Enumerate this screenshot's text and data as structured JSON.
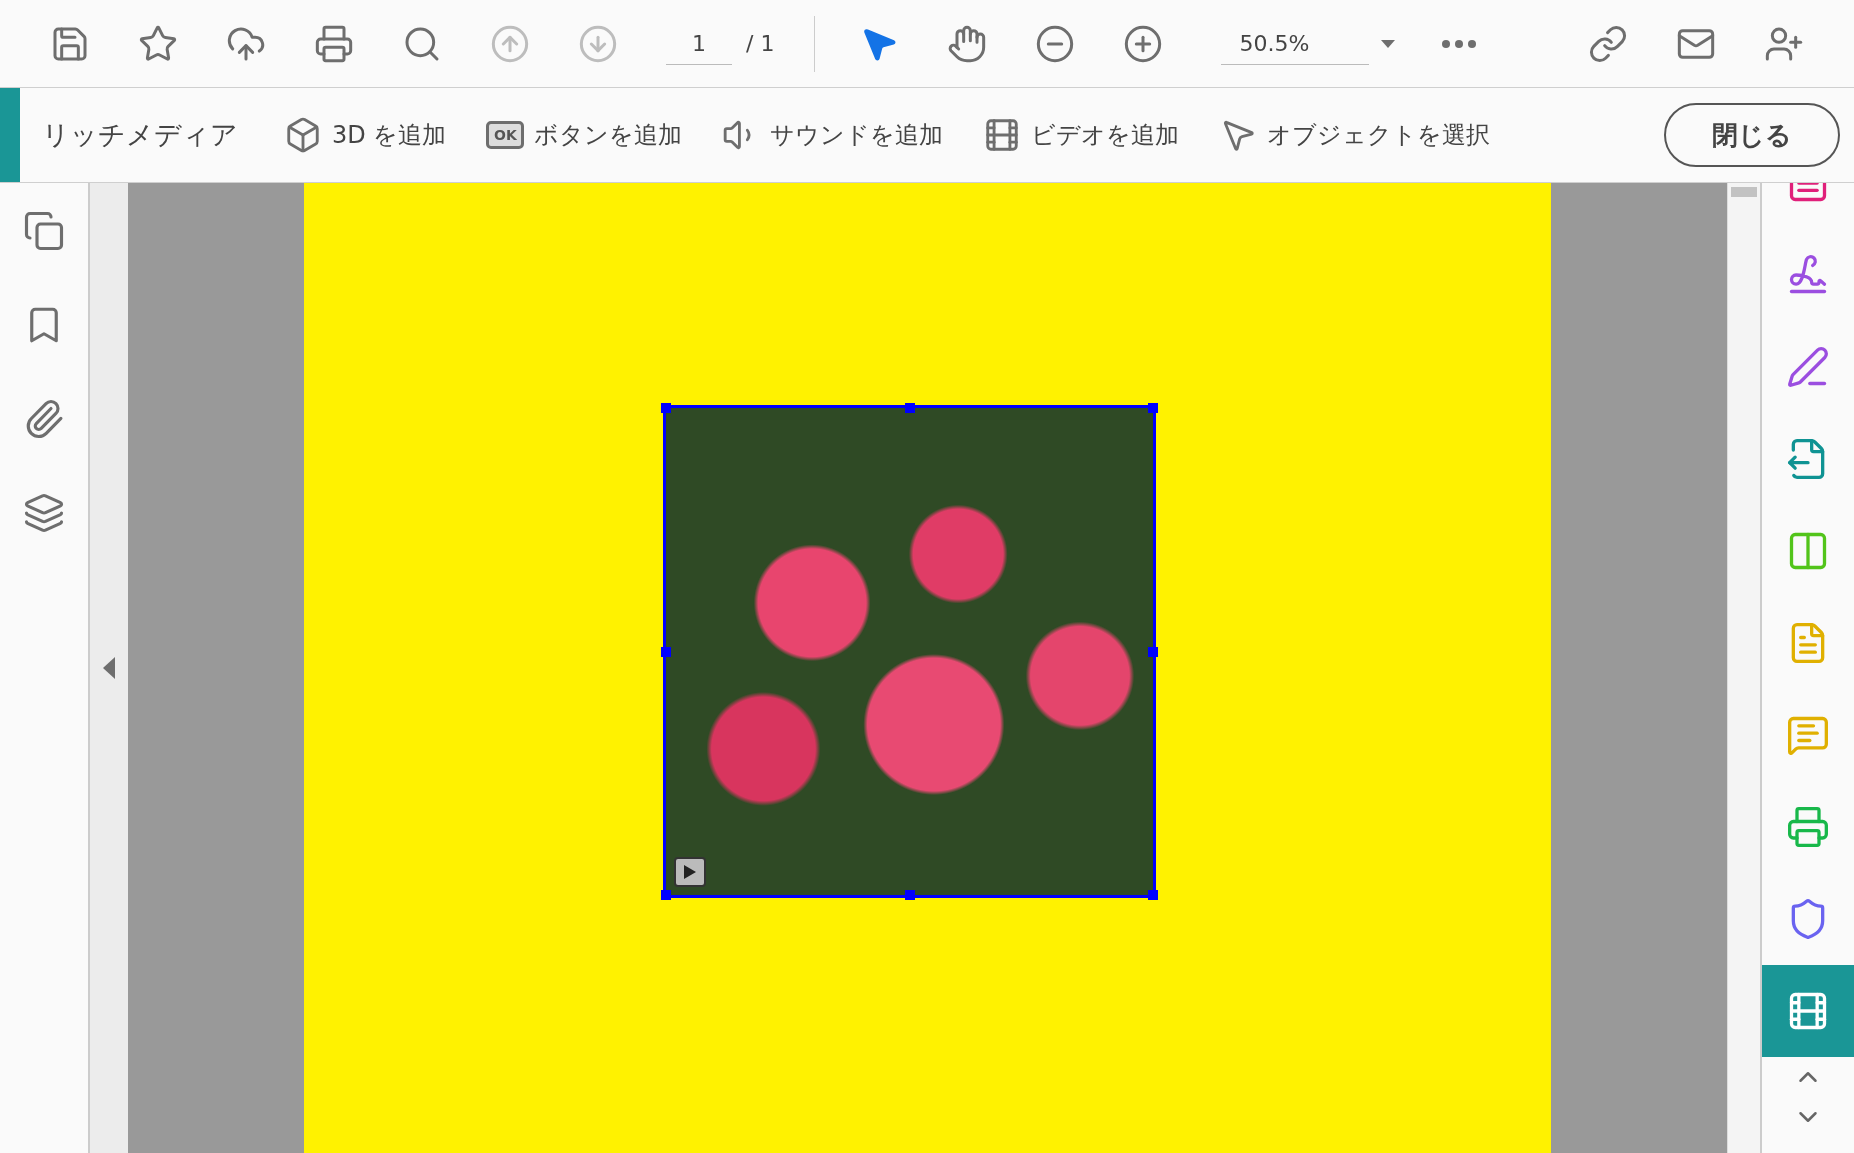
{
  "toolbar": {
    "tools": [
      {
        "kind": "save",
        "disabled": false
      },
      {
        "kind": "star",
        "disabled": false
      },
      {
        "kind": "upload",
        "disabled": false
      },
      {
        "kind": "print",
        "disabled": false
      },
      {
        "kind": "find",
        "disabled": false
      },
      {
        "kind": "prev",
        "disabled": true
      },
      {
        "kind": "next",
        "disabled": true
      }
    ],
    "page_field": {
      "value": "1"
    },
    "page_total": "/ 1",
    "modes": [
      {
        "kind": "select",
        "selected": true
      },
      {
        "kind": "hand",
        "selected": false
      }
    ],
    "zoom_field": {
      "value": "50.5%"
    },
    "share": [
      {
        "kind": "link"
      },
      {
        "kind": "mail"
      },
      {
        "kind": "user-add"
      }
    ]
  },
  "rich_media_bar": {
    "title": "リッチメディア",
    "tools": [
      {
        "kind": "cube",
        "label": "3D を追加"
      },
      {
        "kind": "button",
        "label": "ボタンを追加",
        "icon_text": "OK"
      },
      {
        "kind": "sound",
        "label": "サウンドを追加"
      },
      {
        "kind": "video",
        "label": "ビデオを追加"
      },
      {
        "kind": "select",
        "label": "オブジェクトを選択"
      }
    ],
    "close": "閉じる"
  },
  "left_sidebar": [
    {
      "kind": "pages"
    },
    {
      "kind": "bookmarks"
    },
    {
      "kind": "attachments"
    },
    {
      "kind": "layers"
    }
  ],
  "document": {
    "video": {
      "selected": true
    }
  },
  "right_rail": [
    {
      "kind": "forms",
      "selected": false
    },
    {
      "kind": "fill-sign",
      "selected": false
    },
    {
      "kind": "sign",
      "selected": false
    },
    {
      "kind": "export",
      "selected": false
    },
    {
      "kind": "organize",
      "selected": false
    },
    {
      "kind": "create",
      "selected": false
    },
    {
      "kind": "comment",
      "selected": false
    },
    {
      "kind": "print",
      "selected": false
    },
    {
      "kind": "protect",
      "selected": false
    },
    {
      "kind": "rich-media",
      "selected": true
    }
  ]
}
